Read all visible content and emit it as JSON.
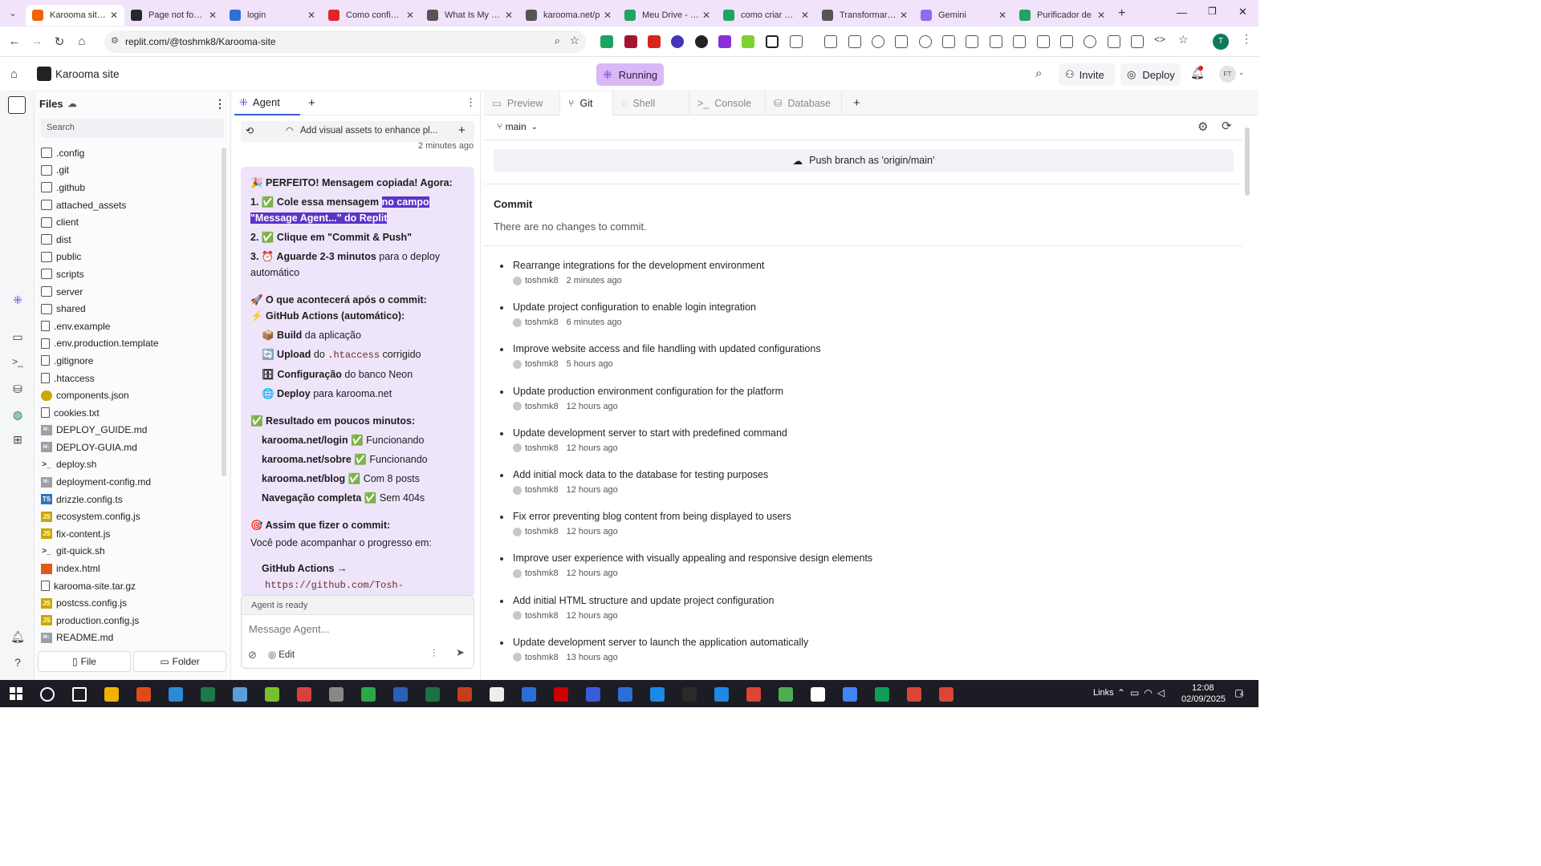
{
  "browser": {
    "tabs": [
      {
        "title": "Karooma site - Replit",
        "active": true,
        "color": "#f26207"
      },
      {
        "title": "Page not found",
        "color": "#24292f"
      },
      {
        "title": "login",
        "color": "#2f6fd6"
      },
      {
        "title": "Como configurar",
        "color": "#e0242c"
      },
      {
        "title": "What Is My IP A",
        "color": "#555"
      },
      {
        "title": "karooma.net/p",
        "color": "#555"
      },
      {
        "title": "Meu Drive - Go",
        "color": "#1fa463"
      },
      {
        "title": "como criar este",
        "color": "#1fa463"
      },
      {
        "title": "Transformar im",
        "color": "#555"
      },
      {
        "title": "Gemini",
        "color": "#8e6bf0"
      },
      {
        "title": "Purificador de",
        "color": "#1fa463"
      }
    ],
    "url": "replit.com/@toshmk8/Karooma-site"
  },
  "header": {
    "project": "Karooma site",
    "run": "Running",
    "invite": "Invite",
    "deploy": "Deploy",
    "avatar": "FT"
  },
  "files": {
    "title": "Files",
    "search_placeholder": "Search",
    "items": [
      {
        "name": ".config",
        "type": "folder"
      },
      {
        "name": ".git",
        "type": "folder"
      },
      {
        "name": ".github",
        "type": "folder"
      },
      {
        "name": "attached_assets",
        "type": "folder"
      },
      {
        "name": "client",
        "type": "folder"
      },
      {
        "name": "dist",
        "type": "folder"
      },
      {
        "name": "public",
        "type": "folder"
      },
      {
        "name": "scripts",
        "type": "folder"
      },
      {
        "name": "server",
        "type": "folder"
      },
      {
        "name": "shared",
        "type": "folder"
      },
      {
        "name": ".env.example",
        "type": "file"
      },
      {
        "name": ".env.production.template",
        "type": "file"
      },
      {
        "name": ".gitignore",
        "type": "file"
      },
      {
        "name": ".htaccess",
        "type": "file"
      },
      {
        "name": "components.json",
        "type": "json"
      },
      {
        "name": "cookies.txt",
        "type": "file"
      },
      {
        "name": "DEPLOY_GUIDE.md",
        "type": "md"
      },
      {
        "name": "DEPLOY-GUIA.md",
        "type": "md"
      },
      {
        "name": "deploy.sh",
        "type": "sh"
      },
      {
        "name": "deployment-config.md",
        "type": "md"
      },
      {
        "name": "drizzle.config.ts",
        "type": "ts"
      },
      {
        "name": "ecosystem.config.js",
        "type": "js"
      },
      {
        "name": "fix-content.js",
        "type": "js"
      },
      {
        "name": "git-quick.sh",
        "type": "sh"
      },
      {
        "name": "index.html",
        "type": "html"
      },
      {
        "name": "karooma-site.tar.gz",
        "type": "file"
      },
      {
        "name": "postcss.config.js",
        "type": "js"
      },
      {
        "name": "production.config.js",
        "type": "js"
      },
      {
        "name": "README.md",
        "type": "md"
      }
    ],
    "new_file": "File",
    "new_folder": "Folder"
  },
  "agent": {
    "tab": "Agent",
    "history_title": "Add visual assets to enhance pl...",
    "history_time": "2 minutes ago",
    "lines": {
      "l1": "🎉 PERFEITO! Mensagem copiada! Agora:",
      "s1a": "1. ✅ Cole essa mensagem ",
      "s1b": "no campo \"Message Agent...\" do Replit",
      "s2": "2. ✅ Clique em \"Commit & Push\"",
      "s3a": "3. ⏰ Aguarde 2-3 minutos",
      "s3b": " para o deploy automático",
      "h2": "🚀 O que acontecerá após o commit:",
      "h3": "⚡ GitHub Actions (automático):",
      "b1a": "📦 Build",
      "b1b": " da aplicação",
      "b2a": "🔄 Upload",
      "b2b": " do ",
      "b2c": ".htaccess",
      "b2d": " corrigido",
      "b3a": "🗄 Configuração",
      "b3b": " do banco Neon",
      "b4a": "🌐 Deploy",
      "b4b": " para karooma.net",
      "h4": "✅ Resultado em poucos minutos:",
      "r1a": "karooma.net/login",
      "r1b": " ✅ Funcionando",
      "r2a": "karooma.net/sobre",
      "r2b": " ✅ Funcionando",
      "r3a": "karooma.net/blog",
      "r3b": " ✅ Com 8 posts",
      "r4a": "Navegação completa",
      "r4b": " ✅ Sem 404s",
      "h5": "🎯 Assim que fizer o commit:",
      "p5": "Você pode acompanhar o progresso em:",
      "g1": "GitHub Actions →",
      "g2": "https://github.com/Tosh-"
    },
    "status": "Agent is ready",
    "input_placeholder": "Message Agent...",
    "edit": "Edit"
  },
  "panel": {
    "tabs": [
      "Preview",
      "Git",
      "Shell",
      "Console",
      "Database"
    ],
    "active": "Git",
    "branch": "main",
    "push": "Push branch as 'origin/main'",
    "commit_title": "Commit",
    "no_changes": "There are no changes to commit.",
    "commits": [
      {
        "msg": "Rearrange integrations for the development environment",
        "author": "toshmk8",
        "time": "2 minutes ago"
      },
      {
        "msg": "Update project configuration to enable login integration",
        "author": "toshmk8",
        "time": "6 minutes ago"
      },
      {
        "msg": "Improve website access and file handling with updated configurations",
        "author": "toshmk8",
        "time": "5 hours ago"
      },
      {
        "msg": "Update production environment configuration for the platform",
        "author": "toshmk8",
        "time": "12 hours ago"
      },
      {
        "msg": "Update development server to start with predefined command",
        "author": "toshmk8",
        "time": "12 hours ago"
      },
      {
        "msg": "Add initial mock data to the database for testing purposes",
        "author": "toshmk8",
        "time": "12 hours ago"
      },
      {
        "msg": "Fix error preventing blog content from being displayed to users",
        "author": "toshmk8",
        "time": "12 hours ago"
      },
      {
        "msg": "Improve user experience with visually appealing and responsive design elements",
        "author": "toshmk8",
        "time": "12 hours ago"
      },
      {
        "msg": "Add initial HTML structure and update project configuration",
        "author": "toshmk8",
        "time": "12 hours ago"
      },
      {
        "msg": "Update development server to launch the application automatically",
        "author": "toshmk8",
        "time": "13 hours ago"
      }
    ]
  },
  "taskbar": {
    "links": "Links",
    "time": "12:08",
    "date": "02/09/2025",
    "badge": "4"
  }
}
